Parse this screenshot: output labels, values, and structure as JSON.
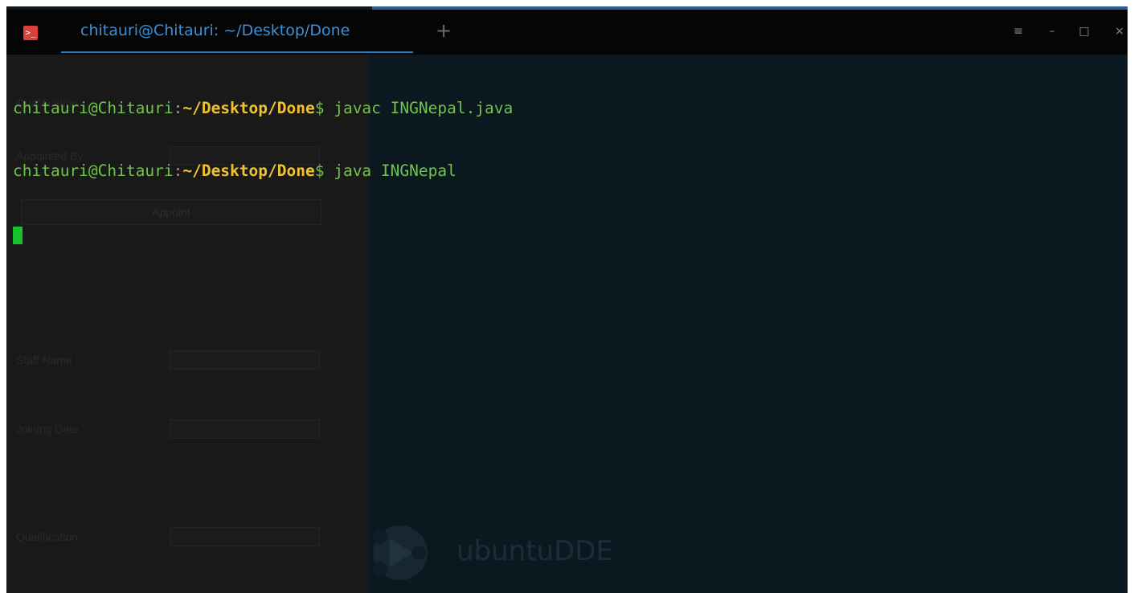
{
  "window": {
    "tab_title": "chitauri@Chitauri: ~/Desktop/Done",
    "new_tab_symbol": "+",
    "controls": {
      "menu": "≡",
      "minimize": "–",
      "maximize": "□",
      "close": "×"
    }
  },
  "terminal": {
    "lines": [
      {
        "user": "chitauri@Chitauri",
        "sep": ":",
        "path": "~/Desktop/Done",
        "prompt": "$",
        "command": " javac INGNepal.java"
      },
      {
        "user": "chitauri@Chitauri",
        "sep": ":",
        "path": "~/Desktop/Done",
        "prompt": "$",
        "command": " java INGNepal"
      }
    ]
  },
  "background_form": {
    "top_label": "Qualification",
    "appointed_by_label": "Appointed By :",
    "appoint_button": "Appoint",
    "staff_name_label": "Staff Name :",
    "joining_date_label": "Joining Date :",
    "qualification_label": "Qualification :"
  },
  "desktop": {
    "watermark": "ubuntuDDE"
  },
  "colors": {
    "terminal_bg": "#0b1820",
    "titlebar_bg": "#050505",
    "tab_text": "#3d8fd6",
    "user_green": "#6fc44a",
    "path_yellow": "#f0c330",
    "cursor_green": "#19c22a"
  },
  "icons": {
    "app": "terminal-icon",
    "menu": "hamburger-menu-icon",
    "minimize": "minimize-icon",
    "maximize": "maximize-icon",
    "close": "close-icon"
  }
}
